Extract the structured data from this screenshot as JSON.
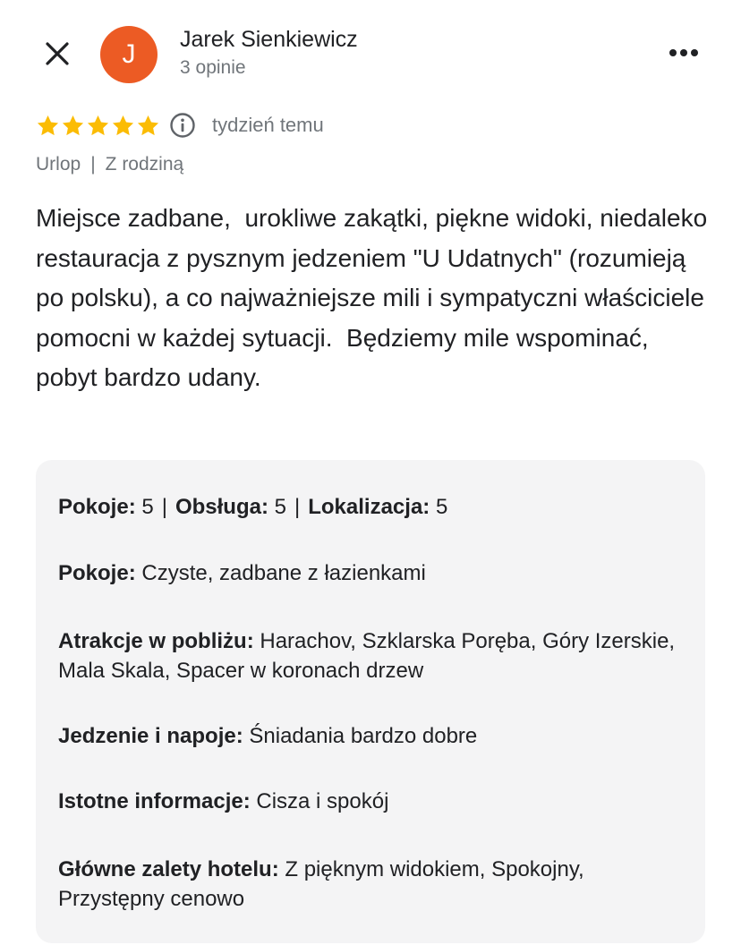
{
  "header": {
    "user_name": "Jarek Sienkiewicz",
    "user_meta": "3 opinie",
    "avatar_initial": "J",
    "avatar_color": "#ec5b24",
    "close_icon": "close-icon",
    "more_icon": "more-horizontal-icon"
  },
  "rating": {
    "stars": 5,
    "max_stars": 5,
    "star_color": "#fbbc04",
    "date": "tydzień temu"
  },
  "tags": [
    "Urlop",
    "Z rodziną"
  ],
  "review": {
    "text": "Miejsce zadbane,  urokliwe zakątki, piękne widoki, niedaleko restauracja z pysznym jedzeniem \"U Udatnych\" (rozumieją po polsku), a co najważniejsze mili i sympatyczni właściciele pomocni w każdej sytuacji.  Będziemy mile wspominać, pobyt bardzo udany."
  },
  "details": {
    "scores": [
      {
        "label": "Pokoje:",
        "value": "5"
      },
      {
        "label": "Obsługa:",
        "value": "5"
      },
      {
        "label": "Lokalizacja:",
        "value": "5"
      }
    ],
    "items": [
      {
        "label": "Pokoje:",
        "value": "Czyste, zadbane z łazienkami"
      },
      {
        "label": "Atrakcje w pobliżu:",
        "value": "Harachov, Szklarska Poręba, Góry Izerskie,  Mala Skala,  Spacer w koronach drzew"
      },
      {
        "label": "Jedzenie i napoje:",
        "value": "Śniadania bardzo dobre"
      },
      {
        "label": "Istotne informacje:",
        "value": "Cisza i spokój"
      },
      {
        "label": "Główne zalety hotelu:",
        "value": "Z pięknym widokiem, Spokojny, Przystępny cenowo"
      }
    ]
  }
}
